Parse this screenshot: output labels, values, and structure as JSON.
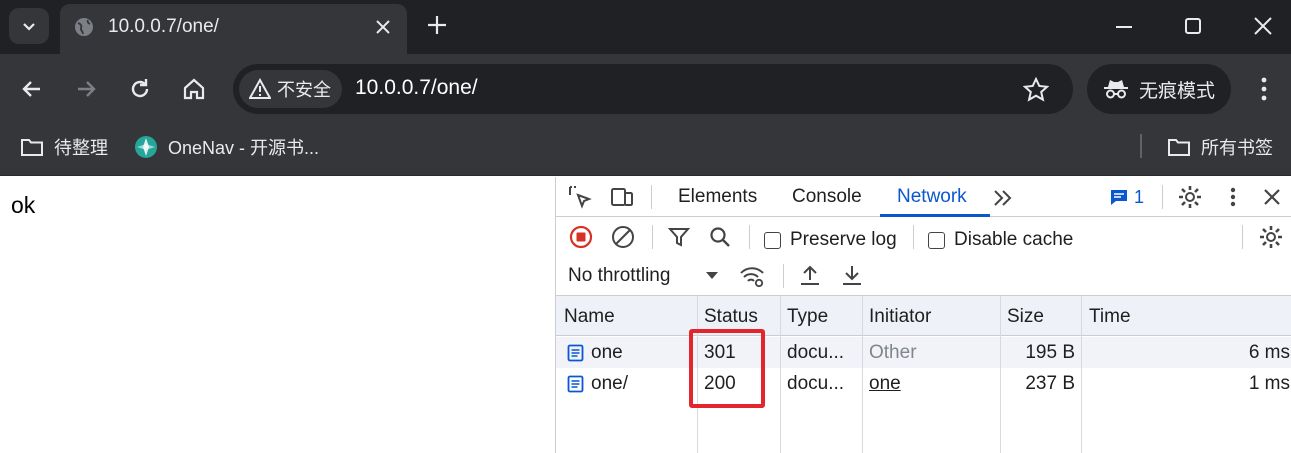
{
  "browser": {
    "tab_title": "10.0.0.7/one/",
    "security_label": "不安全",
    "url": "10.0.0.7/one/",
    "incognito_label": "无痕模式",
    "bookmarks": [
      {
        "label": "待整理",
        "icon": "folder-icon"
      },
      {
        "label": "OneNav - 开源书...",
        "icon": "onenav-icon"
      }
    ],
    "all_bookmarks_label": "所有书签"
  },
  "page": {
    "body_text": "ok"
  },
  "devtools": {
    "tabs": [
      "Elements",
      "Console",
      "Network"
    ],
    "active_tab": "Network",
    "issues_count": "1",
    "preserve_log_label": "Preserve log",
    "disable_cache_label": "Disable cache",
    "throttling_value": "No throttling",
    "columns": [
      "Name",
      "Status",
      "Type",
      "Initiator",
      "Size",
      "Time"
    ],
    "requests": [
      {
        "name": "one",
        "status": "301",
        "type": "docu...",
        "initiator": "Other",
        "size": "195 B",
        "time": "6 ms"
      },
      {
        "name": "one/",
        "status": "200",
        "type": "docu...",
        "initiator": "one",
        "size": "237 B",
        "time": "1 ms"
      }
    ]
  },
  "colors": {
    "accent": "#0b57d0",
    "record_red": "#d93025",
    "highlight_red": "#e3252d"
  }
}
